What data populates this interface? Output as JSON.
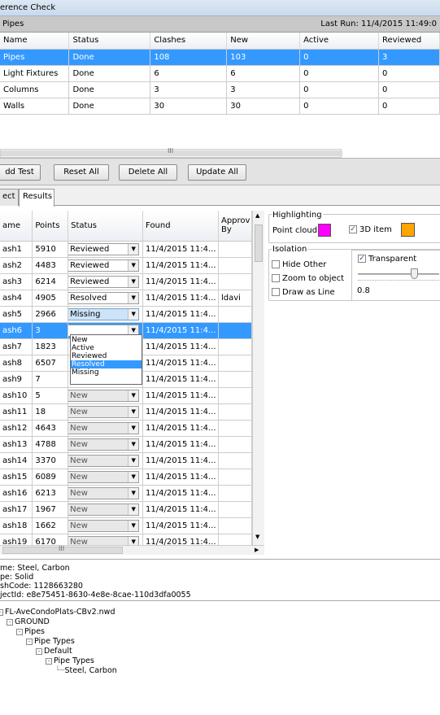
{
  "window": {
    "title": "erence Check"
  },
  "test_header": {
    "name": "Pipes",
    "last_run": "Last Run:  11/4/2015 11:49:0"
  },
  "tests_table": {
    "columns": [
      "Name",
      "Status",
      "Clashes",
      "New",
      "Active",
      "Reviewed"
    ],
    "rows": [
      [
        "Pipes",
        "Done",
        "108",
        "103",
        "0",
        "3"
      ],
      [
        "Light Fixtures",
        "Done",
        "6",
        "6",
        "0",
        "0"
      ],
      [
        "Columns",
        "Done",
        "3",
        "3",
        "0",
        "0"
      ],
      [
        "Walls",
        "Done",
        "30",
        "30",
        "0",
        "0"
      ]
    ],
    "selected_row": 0
  },
  "scroll_grip": "III",
  "buttons": {
    "add_test": "dd Test",
    "reset_all": "Reset All",
    "delete_all": "Delete All",
    "update_all": "Update All"
  },
  "tabs": {
    "select": "ect",
    "results": "Results"
  },
  "results_table": {
    "columns": [
      "ame",
      "Points",
      "Status",
      "Found",
      "Approv\nBy"
    ],
    "rows": [
      {
        "name": "ash1",
        "points": "5910",
        "status": "Reviewed",
        "found": "11/4/2015 11:4...",
        "by": ""
      },
      {
        "name": "ash2",
        "points": "4483",
        "status": "Reviewed",
        "found": "11/4/2015 11:4...",
        "by": ""
      },
      {
        "name": "ash3",
        "points": "6214",
        "status": "Reviewed",
        "found": "11/4/2015 11:4...",
        "by": ""
      },
      {
        "name": "ash4",
        "points": "4905",
        "status": "Resolved",
        "found": "11/4/2015 11:4...",
        "by": "ldavi"
      },
      {
        "name": "ash5",
        "points": "2966",
        "status": "Missing",
        "found": "11/4/2015 11:4...",
        "by": ""
      },
      {
        "name": "ash6",
        "points": "3",
        "status": "New",
        "found": "11/4/2015 11:4...",
        "by": ""
      },
      {
        "name": "ash7",
        "points": "1823",
        "status": "",
        "found": "11/4/2015 11:4...",
        "by": ""
      },
      {
        "name": "ash8",
        "points": "6507",
        "status": "",
        "found": "11/4/2015 11:4...",
        "by": ""
      },
      {
        "name": "ash9",
        "points": "7",
        "status": "",
        "found": "11/4/2015 11:4...",
        "by": ""
      },
      {
        "name": "ash10",
        "points": "5",
        "status": "New",
        "found": "11/4/2015 11:4...",
        "by": ""
      },
      {
        "name": "ash11",
        "points": "18",
        "status": "New",
        "found": "11/4/2015 11:4...",
        "by": ""
      },
      {
        "name": "ash12",
        "points": "4643",
        "status": "New",
        "found": "11/4/2015 11:4...",
        "by": ""
      },
      {
        "name": "ash13",
        "points": "4788",
        "status": "New",
        "found": "11/4/2015 11:4...",
        "by": ""
      },
      {
        "name": "ash14",
        "points": "3370",
        "status": "New",
        "found": "11/4/2015 11:4...",
        "by": ""
      },
      {
        "name": "ash15",
        "points": "6089",
        "status": "New",
        "found": "11/4/2015 11:4...",
        "by": ""
      },
      {
        "name": "ash16",
        "points": "6213",
        "status": "New",
        "found": "11/4/2015 11:4...",
        "by": ""
      },
      {
        "name": "ash17",
        "points": "1967",
        "status": "New",
        "found": "11/4/2015 11:4...",
        "by": ""
      },
      {
        "name": "ash18",
        "points": "1662",
        "status": "New",
        "found": "11/4/2015 11:4...",
        "by": ""
      },
      {
        "name": "ash19",
        "points": "6170",
        "status": "New",
        "found": "11/4/2015 11:4...",
        "by": ""
      }
    ],
    "selected_row": 5
  },
  "status_dropdown": {
    "options": [
      "New",
      "Active",
      "Reviewed",
      "Resolved",
      "Missing"
    ],
    "highlighted": "Resolved"
  },
  "highlighting": {
    "title": "Highlighting",
    "point_cloud_label": "Point cloud",
    "point_cloud_color": "#ff00ff",
    "item_label": "3D item",
    "item_checked": true,
    "item_color": "#ffa500"
  },
  "isolation": {
    "title": "Isolation",
    "hide_other": "Hide Other",
    "zoom_to_object": "Zoom to object",
    "draw_as_line": "Draw as Line",
    "transparent": "Transparent",
    "transparent_checked": true,
    "transparency_value": "0.8"
  },
  "properties": [
    "me: Steel, Carbon",
    "pe: Solid",
    "shCode: 1128663280",
    "jectId: e8e75451-8630-4e8e-8cae-110d3dfa0055"
  ],
  "tree": [
    {
      "label": "FL-AveCondoPlats-CBv2.nwd",
      "depth": 0,
      "expander": "-"
    },
    {
      "label": "GROUND",
      "depth": 1,
      "expander": "-"
    },
    {
      "label": "Pipes",
      "depth": 2,
      "expander": "-"
    },
    {
      "label": "Pipe Types",
      "depth": 3,
      "expander": "-"
    },
    {
      "label": "Default",
      "depth": 4,
      "expander": "-"
    },
    {
      "label": "Pipe Types",
      "depth": 5,
      "expander": "-"
    },
    {
      "label": "Steel, Carbon",
      "depth": 6,
      "expander": ""
    }
  ]
}
